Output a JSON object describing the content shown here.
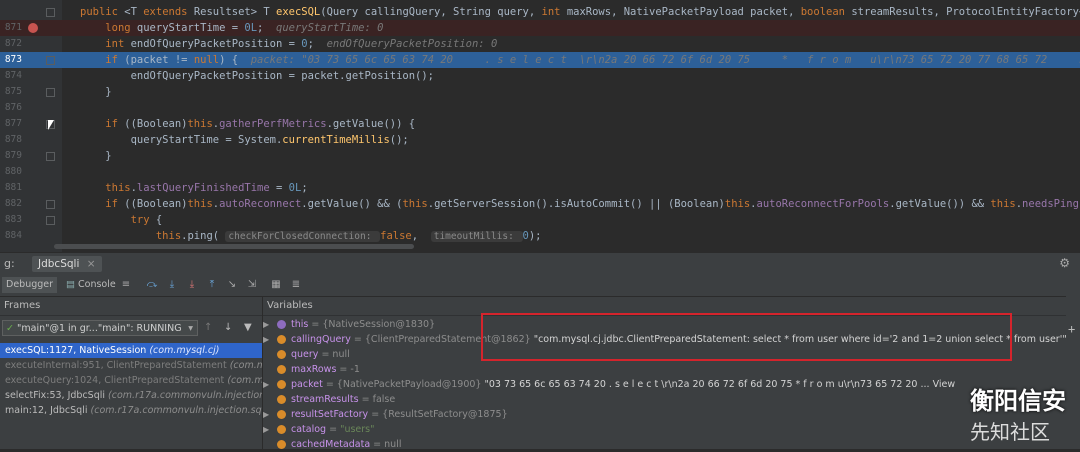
{
  "editor": {
    "lines": [
      {
        "num": "",
        "segments": [
          [
            "kw",
            "public "
          ],
          [
            "ty",
            "<T "
          ],
          [
            "kw",
            "extends "
          ],
          [
            "ty",
            "Resultset> T "
          ],
          [
            "mth",
            "execSQL"
          ],
          [
            "ty",
            "(Query callingQuery, String query, "
          ],
          [
            "kw",
            "int "
          ],
          [
            "ty",
            "maxRows, NativePacketPayload packet, "
          ],
          [
            "kw",
            "boolean "
          ],
          [
            "ty",
            "streamResults, ProtocolEntityFactory<T, N"
          ]
        ]
      },
      {
        "num": "871",
        "segments": [
          [
            "ty",
            "    "
          ],
          [
            "kw",
            "long "
          ],
          [
            "ty",
            "queryStartTime = "
          ],
          [
            "num",
            "0L"
          ],
          [
            "ty",
            ";  "
          ],
          [
            "hint",
            "queryStartTime: 0"
          ]
        ]
      },
      {
        "num": "872",
        "segments": [
          [
            "ty",
            "    "
          ],
          [
            "kw",
            "int "
          ],
          [
            "ty",
            "endOfQueryPacketPosition = "
          ],
          [
            "num",
            "0"
          ],
          [
            "ty",
            ";  "
          ],
          [
            "hint",
            "endOfQueryPacketPosition: 0"
          ]
        ]
      },
      {
        "num": "873",
        "segments": [
          [
            "ty",
            "    "
          ],
          [
            "kw",
            "if "
          ],
          [
            "ty",
            "(packet != "
          ],
          [
            "kw",
            "null"
          ],
          [
            "ty",
            ") {  "
          ],
          [
            "hint",
            "packet: \"03 73 65 6c 65 63 74 20     . s e l e c t  \\r\\n2a 20 66 72 6f 6d 20 75     *   f r o m   u\\r\\n73 65 72 20 77 68 65 72     s e r"
          ]
        ]
      },
      {
        "num": "874",
        "segments": [
          [
            "ty",
            "        endOfQueryPacketPosition = packet.getPosition();"
          ]
        ]
      },
      {
        "num": "875",
        "segments": [
          [
            "ty",
            "    }"
          ]
        ]
      },
      {
        "num": "876",
        "segments": []
      },
      {
        "num": "877",
        "segments": [
          [
            "ty",
            "    "
          ],
          [
            "kw",
            "if "
          ],
          [
            "ty",
            "((Boolean)"
          ],
          [
            "kw",
            "this"
          ],
          [
            "ty",
            "."
          ],
          [
            "fld",
            "gatherPerfMetrics"
          ],
          [
            "ty",
            ".getValue()) {"
          ]
        ]
      },
      {
        "num": "878",
        "segments": [
          [
            "ty",
            "        queryStartTime = System."
          ],
          [
            "mth",
            "currentTimeMillis"
          ],
          [
            "ty",
            "();"
          ]
        ]
      },
      {
        "num": "879",
        "segments": [
          [
            "ty",
            "    }"
          ]
        ]
      },
      {
        "num": "880",
        "segments": []
      },
      {
        "num": "881",
        "segments": [
          [
            "ty",
            "    "
          ],
          [
            "kw",
            "this"
          ],
          [
            "ty",
            "."
          ],
          [
            "fld",
            "lastQueryFinishedTime"
          ],
          [
            "ty",
            " = "
          ],
          [
            "num",
            "0L"
          ],
          [
            "ty",
            ";"
          ]
        ]
      },
      {
        "num": "882",
        "segments": [
          [
            "ty",
            "    "
          ],
          [
            "kw",
            "if "
          ],
          [
            "ty",
            "((Boolean)"
          ],
          [
            "kw",
            "this"
          ],
          [
            "ty",
            "."
          ],
          [
            "fld",
            "autoReconnect"
          ],
          [
            "ty",
            ".getValue() && ("
          ],
          [
            "kw",
            "this"
          ],
          [
            "ty",
            ".getServerSession().isAutoCommit() || (Boolean)"
          ],
          [
            "kw",
            "this"
          ],
          [
            "ty",
            "."
          ],
          [
            "fld",
            "autoReconnectForPools"
          ],
          [
            "ty",
            ".getValue()) && "
          ],
          [
            "kw",
            "this"
          ],
          [
            "ty",
            "."
          ],
          [
            "fld",
            "needsPing"
          ],
          [
            "ty",
            " && !"
          ]
        ]
      },
      {
        "num": "883",
        "segments": [
          [
            "ty",
            "        "
          ],
          [
            "kw",
            "try "
          ],
          [
            "ty",
            "{"
          ]
        ]
      },
      {
        "num": "884",
        "segments": [
          [
            "ty",
            "            "
          ],
          [
            "kw",
            "this"
          ],
          [
            "ty",
            ".ping( "
          ],
          [
            "hint",
            "checkForClosedConnection: "
          ],
          [
            "kw",
            "false"
          ],
          [
            "ty",
            ",  "
          ],
          [
            "hint",
            "timeoutMillis: "
          ],
          [
            "num",
            "0"
          ],
          [
            "ty",
            ");"
          ]
        ]
      }
    ]
  },
  "debug": {
    "title_prefix": "g:",
    "session_tab": "JdbcSqli",
    "tabs": {
      "debugger": "Debugger",
      "console": "Console"
    },
    "frames_header": "Frames",
    "variables_header": "Variables",
    "thread_label": "\"main\"@1 in gr...\"main\": RUNNING",
    "frames": [
      {
        "method": "execSQL:1127, NativeSession ",
        "cls": "(com.mysql.cj)"
      },
      {
        "method": "executeInternal:951, ClientPreparedStatement ",
        "cls": "(com.mysq"
      },
      {
        "method": "executeQuery:1024, ClientPreparedStatement ",
        "cls": "(com.mysq"
      },
      {
        "method": "selectFix:53, JdbcSqli ",
        "cls": "(com.r17a.commonvuln.injection.sqli"
      },
      {
        "method": "main:12, JdbcSqli ",
        "cls": "(com.r17a.commonvuln.injection.sqli)"
      }
    ],
    "variables": [
      {
        "name": "this",
        "type": " = {NativeSession@1830}",
        "value": ""
      },
      {
        "name": "callingQuery",
        "type": " = {ClientPreparedStatement@1862} ",
        "value": "\"com.mysql.cj.jdbc.ClientPreparedStatement: select * from user where id='2 and 1=2 union select * from user'\""
      },
      {
        "name": "query",
        "type": " = null",
        "value": ""
      },
      {
        "name": "maxRows",
        "type": " = -1",
        "value": ""
      },
      {
        "name": "packet",
        "type": " = {NativePacketPayload@1900} ",
        "value": "\"03 73 65 6c 65 63 74 20     . s e l e c t  \\r\\n2a 20 66 72 6f 6d 20 75     *   f r o m   u\\r\\n73 65 72 20 ... View"
      },
      {
        "name": "streamResults",
        "type": " = false",
        "value": ""
      },
      {
        "name": "resultSetFactory",
        "type": " = {ResultSetFactory@1875}",
        "value": ""
      },
      {
        "name": "catalog",
        "type": " = ",
        "value": "\"users\""
      },
      {
        "name": "cachedMetadata",
        "type": " = null",
        "value": ""
      }
    ]
  },
  "watermark": {
    "line1": "衡阳信安",
    "line2": "先知社区"
  }
}
